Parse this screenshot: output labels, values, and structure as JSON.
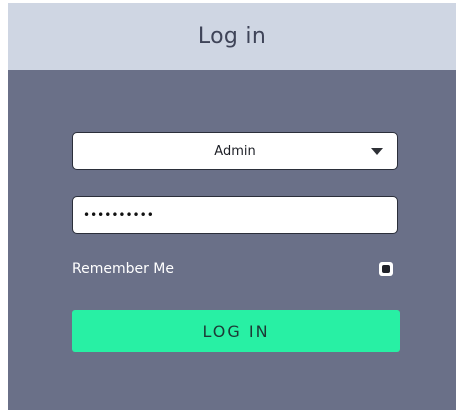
{
  "header": {
    "title": "Log in"
  },
  "form": {
    "user_select": {
      "value": "Admin",
      "icon": "chevron-down-icon"
    },
    "password": {
      "value": "••••••••••"
    },
    "remember": {
      "label": "Remember Me",
      "checked": true
    },
    "submit_label": "LOG IN"
  },
  "colors": {
    "panel_bg": "#6a7088",
    "header_bg": "#cfd6e3",
    "accent": "#28f0a4"
  }
}
